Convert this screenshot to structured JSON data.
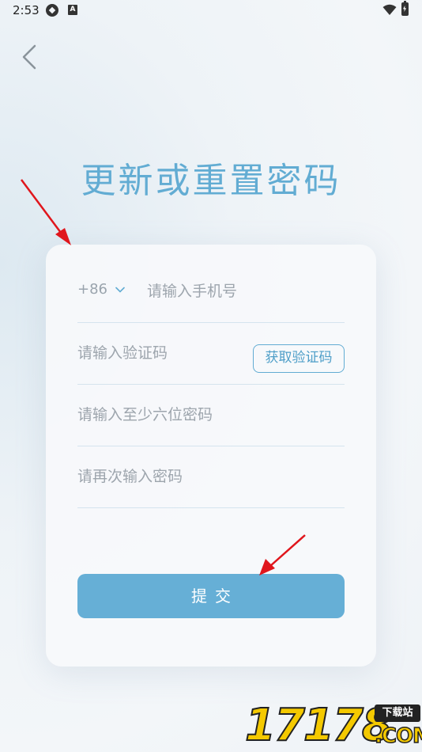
{
  "status_bar": {
    "time": "2:53",
    "icons": [
      "app-notification-icon",
      "a-letter-icon",
      "wifi-icon",
      "battery-icon"
    ],
    "a_badge_text": "A"
  },
  "header": {
    "back_icon": "chevron-left-icon",
    "title": "更新或重置密码"
  },
  "form": {
    "country_code": "+86",
    "phone_placeholder": "请输入手机号",
    "code_placeholder": "请输入验证码",
    "get_code_label": "获取验证码",
    "password_placeholder": "请输入至少六位密码",
    "confirm_password_placeholder": "请再次输入密码",
    "submit_label": "提交"
  },
  "watermark": {
    "digits": "17178",
    "badge": "下载站",
    "suffix": ".COM"
  },
  "colors": {
    "accent": "#62acd3",
    "button_bg": "#66afd6",
    "annotation": "#e0161c",
    "watermark_yellow": "#f4c900"
  }
}
